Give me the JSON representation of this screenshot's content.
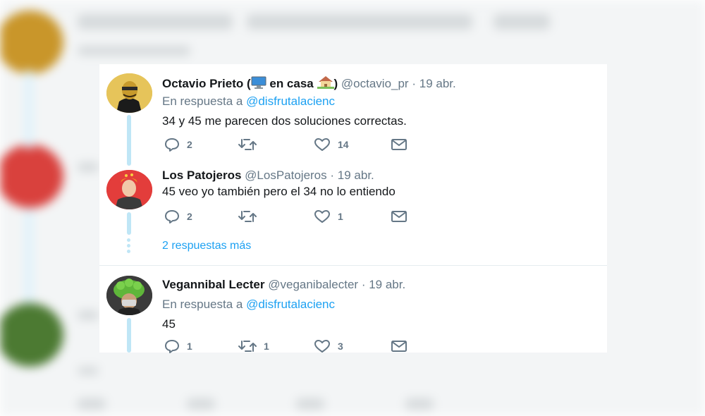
{
  "colors": {
    "link": "#1da1f2",
    "text": "#14171a",
    "muted": "#657786",
    "thread": "#bfe6f6"
  },
  "tweets": [
    {
      "name": "Octavio Prieto (",
      "name_status": "en casa",
      "name_close": ")",
      "status_icons": [
        "computer-icon",
        "house-icon"
      ],
      "handle": "@octavio_pr",
      "separator": "·",
      "date": "19 abr.",
      "reply_prefix": "En respuesta a",
      "reply_to": "@disfrutalacienc",
      "text": "34 y 45 me parecen dos soluciones correctas.",
      "replies": "2",
      "retweets": "",
      "likes": "14"
    },
    {
      "name": "Los Patojeros",
      "handle": "@LosPatojeros",
      "separator": "·",
      "date": "19 abr.",
      "text": "45 veo yo también pero el 34 no lo entiendo",
      "replies": "2",
      "retweets": "",
      "likes": "1"
    },
    {
      "name": "Vegannibal Lecter",
      "handle": "@veganibalecter",
      "separator": "·",
      "date": "19 abr.",
      "reply_prefix": "En respuesta a",
      "reply_to": "@disfrutalacienc",
      "text": "45",
      "replies": "1",
      "retweets": "1",
      "likes": "3"
    }
  ],
  "more_replies": "2 respuestas más"
}
